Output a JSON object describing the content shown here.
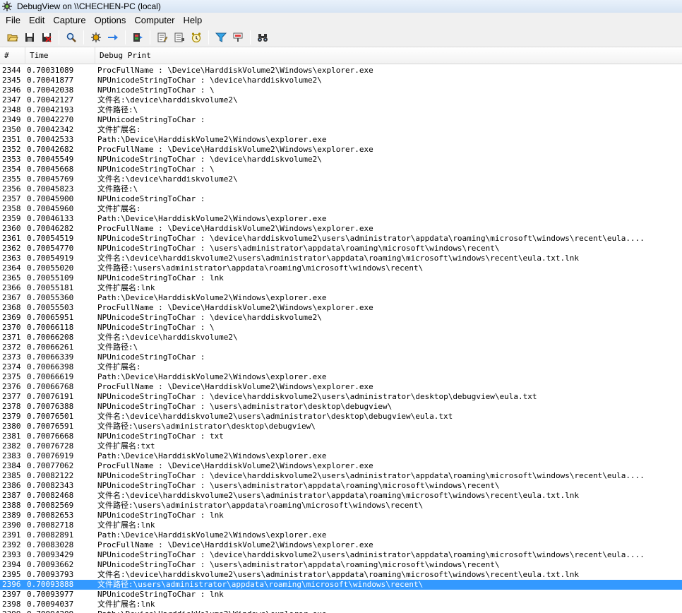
{
  "window": {
    "title": "DebugView on \\\\CHECHEN-PC (local)"
  },
  "menu": [
    "File",
    "Edit",
    "Capture",
    "Options",
    "Computer",
    "Help"
  ],
  "toolbar_icons": [
    "open-icon",
    "save-icon",
    "clear-icon",
    "find-icon",
    "capture-icon",
    "arrow-icon",
    "capture-kernel-icon",
    "edit-icon",
    "history-icon",
    "timestamp-icon",
    "filter-icon",
    "highlight-icon",
    "binoculars-icon"
  ],
  "columns": {
    "num": "#",
    "time": "Time",
    "print": "Debug Print"
  },
  "selected_index": 52,
  "rows": [
    {
      "n": "2344",
      "t": "0.70031089",
      "m": "ProcFullName : \\Device\\HarddiskVolume2\\Windows\\explorer.exe"
    },
    {
      "n": "2345",
      "t": "0.70041877",
      "m": "NPUnicodeStringToChar : \\device\\harddiskvolume2\\"
    },
    {
      "n": "2346",
      "t": "0.70042038",
      "m": "NPUnicodeStringToChar : \\"
    },
    {
      "n": "2347",
      "t": "0.70042127",
      "m": "文件名:\\device\\harddiskvolume2\\"
    },
    {
      "n": "2348",
      "t": "0.70042193",
      "m": "文件路径:\\"
    },
    {
      "n": "2349",
      "t": "0.70042270",
      "m": "NPUnicodeStringToChar :"
    },
    {
      "n": "2350",
      "t": "0.70042342",
      "m": "文件扩展名:"
    },
    {
      "n": "2351",
      "t": "0.70042533",
      "m": "Path:\\Device\\HarddiskVolume2\\Windows\\explorer.exe"
    },
    {
      "n": "2352",
      "t": "0.70042682",
      "m": "ProcFullName : \\Device\\HarddiskVolume2\\Windows\\explorer.exe"
    },
    {
      "n": "2353",
      "t": "0.70045549",
      "m": "NPUnicodeStringToChar : \\device\\harddiskvolume2\\"
    },
    {
      "n": "2354",
      "t": "0.70045668",
      "m": "NPUnicodeStringToChar : \\"
    },
    {
      "n": "2355",
      "t": "0.70045769",
      "m": "文件名:\\device\\harddiskvolume2\\"
    },
    {
      "n": "2356",
      "t": "0.70045823",
      "m": "文件路径:\\"
    },
    {
      "n": "2357",
      "t": "0.70045900",
      "m": "NPUnicodeStringToChar :"
    },
    {
      "n": "2358",
      "t": "0.70045960",
      "m": "文件扩展名:"
    },
    {
      "n": "2359",
      "t": "0.70046133",
      "m": "Path:\\Device\\HarddiskVolume2\\Windows\\explorer.exe"
    },
    {
      "n": "2360",
      "t": "0.70046282",
      "m": "ProcFullName : \\Device\\HarddiskVolume2\\Windows\\explorer.exe"
    },
    {
      "n": "2361",
      "t": "0.70054519",
      "m": "NPUnicodeStringToChar : \\device\\harddiskvolume2\\users\\administrator\\appdata\\roaming\\microsoft\\windows\\recent\\eula...."
    },
    {
      "n": "2362",
      "t": "0.70054770",
      "m": "NPUnicodeStringToChar : \\users\\administrator\\appdata\\roaming\\microsoft\\windows\\recent\\"
    },
    {
      "n": "2363",
      "t": "0.70054919",
      "m": "文件名:\\device\\harddiskvolume2\\users\\administrator\\appdata\\roaming\\microsoft\\windows\\recent\\eula.txt.lnk"
    },
    {
      "n": "2364",
      "t": "0.70055020",
      "m": "文件路径:\\users\\administrator\\appdata\\roaming\\microsoft\\windows\\recent\\"
    },
    {
      "n": "2365",
      "t": "0.70055109",
      "m": "NPUnicodeStringToChar : lnk"
    },
    {
      "n": "2366",
      "t": "0.70055181",
      "m": "文件扩展名:lnk"
    },
    {
      "n": "2367",
      "t": "0.70055360",
      "m": "Path:\\Device\\HarddiskVolume2\\Windows\\explorer.exe"
    },
    {
      "n": "2368",
      "t": "0.70055503",
      "m": "ProcFullName : \\Device\\HarddiskVolume2\\Windows\\explorer.exe"
    },
    {
      "n": "2369",
      "t": "0.70065951",
      "m": "NPUnicodeStringToChar : \\device\\harddiskvolume2\\"
    },
    {
      "n": "2370",
      "t": "0.70066118",
      "m": "NPUnicodeStringToChar : \\"
    },
    {
      "n": "2371",
      "t": "0.70066208",
      "m": "文件名:\\device\\harddiskvolume2\\"
    },
    {
      "n": "2372",
      "t": "0.70066261",
      "m": "文件路径:\\"
    },
    {
      "n": "2373",
      "t": "0.70066339",
      "m": "NPUnicodeStringToChar :"
    },
    {
      "n": "2374",
      "t": "0.70066398",
      "m": "文件扩展名:"
    },
    {
      "n": "2375",
      "t": "0.70066619",
      "m": "Path:\\Device\\HarddiskVolume2\\Windows\\explorer.exe"
    },
    {
      "n": "2376",
      "t": "0.70066768",
      "m": "ProcFullName : \\Device\\HarddiskVolume2\\Windows\\explorer.exe"
    },
    {
      "n": "2377",
      "t": "0.70076191",
      "m": "NPUnicodeStringToChar : \\device\\harddiskvolume2\\users\\administrator\\desktop\\debugview\\eula.txt"
    },
    {
      "n": "2378",
      "t": "0.70076388",
      "m": "NPUnicodeStringToChar : \\users\\administrator\\desktop\\debugview\\"
    },
    {
      "n": "2379",
      "t": "0.70076501",
      "m": "文件名:\\device\\harddiskvolume2\\users\\administrator\\desktop\\debugview\\eula.txt"
    },
    {
      "n": "2380",
      "t": "0.70076591",
      "m": "文件路径:\\users\\administrator\\desktop\\debugview\\"
    },
    {
      "n": "2381",
      "t": "0.70076668",
      "m": "NPUnicodeStringToChar : txt"
    },
    {
      "n": "2382",
      "t": "0.70076728",
      "m": "文件扩展名:txt"
    },
    {
      "n": "2383",
      "t": "0.70076919",
      "m": "Path:\\Device\\HarddiskVolume2\\Windows\\explorer.exe"
    },
    {
      "n": "2384",
      "t": "0.70077062",
      "m": "ProcFullName : \\Device\\HarddiskVolume2\\Windows\\explorer.exe"
    },
    {
      "n": "2385",
      "t": "0.70082122",
      "m": "NPUnicodeStringToChar : \\device\\harddiskvolume2\\users\\administrator\\appdata\\roaming\\microsoft\\windows\\recent\\eula...."
    },
    {
      "n": "2386",
      "t": "0.70082343",
      "m": "NPUnicodeStringToChar : \\users\\administrator\\appdata\\roaming\\microsoft\\windows\\recent\\"
    },
    {
      "n": "2387",
      "t": "0.70082468",
      "m": "文件名:\\device\\harddiskvolume2\\users\\administrator\\appdata\\roaming\\microsoft\\windows\\recent\\eula.txt.lnk"
    },
    {
      "n": "2388",
      "t": "0.70082569",
      "m": "文件路径:\\users\\administrator\\appdata\\roaming\\microsoft\\windows\\recent\\"
    },
    {
      "n": "2389",
      "t": "0.70082653",
      "m": "NPUnicodeStringToChar : lnk"
    },
    {
      "n": "2390",
      "t": "0.70082718",
      "m": "文件扩展名:lnk"
    },
    {
      "n": "2391",
      "t": "0.70082891",
      "m": "Path:\\Device\\HarddiskVolume2\\Windows\\explorer.exe"
    },
    {
      "n": "2392",
      "t": "0.70083028",
      "m": "ProcFullName : \\Device\\HarddiskVolume2\\Windows\\explorer.exe"
    },
    {
      "n": "2393",
      "t": "0.70093429",
      "m": "NPUnicodeStringToChar : \\device\\harddiskvolume2\\users\\administrator\\appdata\\roaming\\microsoft\\windows\\recent\\eula...."
    },
    {
      "n": "2394",
      "t": "0.70093662",
      "m": "NPUnicodeStringToChar : \\users\\administrator\\appdata\\roaming\\microsoft\\windows\\recent\\"
    },
    {
      "n": "2395",
      "t": "0.70093793",
      "m": "文件名:\\device\\harddiskvolume2\\users\\administrator\\appdata\\roaming\\microsoft\\windows\\recent\\eula.txt.lnk"
    },
    {
      "n": "2396",
      "t": "0.70093888",
      "m": "文件路径:\\users\\administrator\\appdata\\roaming\\microsoft\\windows\\recent\\"
    },
    {
      "n": "2397",
      "t": "0.70093977",
      "m": "NPUnicodeStringToChar : lnk"
    },
    {
      "n": "2398",
      "t": "0.70094037",
      "m": "文件扩展名:lnk"
    },
    {
      "n": "2399",
      "t": "0.70094209",
      "m": "Path:\\Device\\HarddiskVolume2\\Windows\\explorer.exe"
    }
  ]
}
